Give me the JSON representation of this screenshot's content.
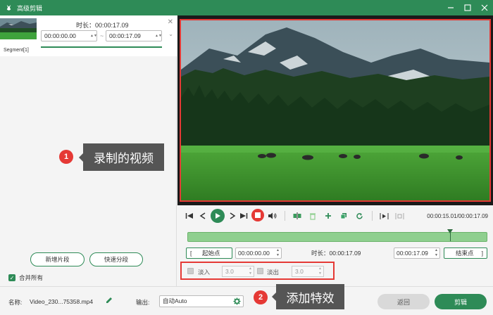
{
  "window": {
    "title": "高级剪辑",
    "icon": "rabbit-logo-icon"
  },
  "segment": {
    "duration": "时长：00:00:17.09",
    "start": "00:00:00.00",
    "end": "00:00:17.09",
    "label": "Segment[1]"
  },
  "left_buttons": {
    "new_segment": "新增片段",
    "quick_split": "快速分段"
  },
  "merge": {
    "label": "合并所有",
    "checked": true
  },
  "callouts": [
    {
      "number": "1",
      "text": "录制的视频"
    },
    {
      "number": "2",
      "text": "添加特效"
    }
  ],
  "playback": {
    "timecode": "00:00:15.01/00:00:17.09",
    "position": 0.878
  },
  "range": {
    "start_label": "起始点",
    "start_value": "00:00:00.00",
    "duration_label": "时长：00:00:17.09",
    "end_value": "00:00:17.09",
    "end_label": "结束点"
  },
  "effects": {
    "fade_in_label": "淡入",
    "fade_in_value": "3.0",
    "fade_out_label": "淡出",
    "fade_out_value": "3.0"
  },
  "bottom": {
    "name_label": "名称:",
    "name_value": "Video_230...75358.mp4",
    "output_label": "输出:",
    "output_value": "自动Auto",
    "back_button": "返回",
    "cut_button": "剪辑"
  },
  "colors": {
    "accent": "#2e8b57",
    "highlight": "#e53935",
    "timeline": "#8fcf8f"
  }
}
